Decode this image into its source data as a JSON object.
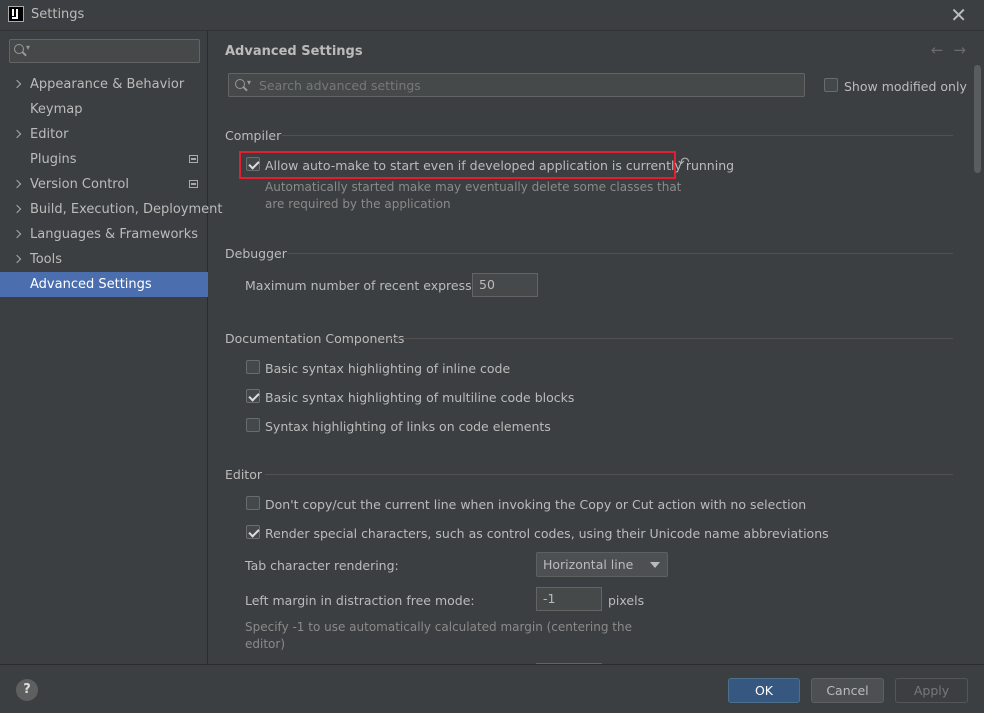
{
  "window": {
    "title": "Settings"
  },
  "sidebar": {
    "search_placeholder": "",
    "items": [
      {
        "label": "Appearance & Behavior"
      },
      {
        "label": "Keymap"
      },
      {
        "label": "Editor"
      },
      {
        "label": "Plugins"
      },
      {
        "label": "Version Control"
      },
      {
        "label": "Build, Execution, Deployment"
      },
      {
        "label": "Languages & Frameworks"
      },
      {
        "label": "Tools"
      },
      {
        "label": "Advanced Settings"
      }
    ]
  },
  "main": {
    "title": "Advanced Settings",
    "search_placeholder": "Search advanced settings",
    "show_modified_label": "Show modified only",
    "compiler": {
      "heading": "Compiler",
      "auto_make_label": "Allow auto-make to start even if developed application is currently running",
      "auto_make_hint_1": "Automatically started make may eventually delete some classes that",
      "auto_make_hint_2": "are required by the application"
    },
    "debugger": {
      "heading": "Debugger",
      "recent_expr_label": "Maximum number of recent expressions:",
      "recent_expr_value": "50"
    },
    "docs": {
      "heading": "Documentation Components",
      "inline_label": "Basic syntax highlighting of inline code",
      "multiline_label": "Basic syntax highlighting of multiline code blocks",
      "links_label": "Syntax highlighting of links on code elements"
    },
    "editor": {
      "heading": "Editor",
      "copy_cut_label": "Don't copy/cut the current line when invoking the Copy or Cut action with no selection",
      "render_special_label": "Render special characters, such as control codes, using their Unicode name abbreviations",
      "tab_rendering_label": "Tab character rendering:",
      "tab_rendering_value": "Horizontal line",
      "left_margin_label": "Left margin in distraction free mode:",
      "left_margin_value": "-1",
      "left_margin_unit": "pixels",
      "left_margin_hint_1": "Specify -1 to use automatically calculated margin (centering the",
      "left_margin_hint_2": "editor)"
    }
  },
  "footer": {
    "help_label": "?",
    "ok_label": "OK",
    "cancel_label": "Cancel",
    "apply_label": "Apply"
  }
}
